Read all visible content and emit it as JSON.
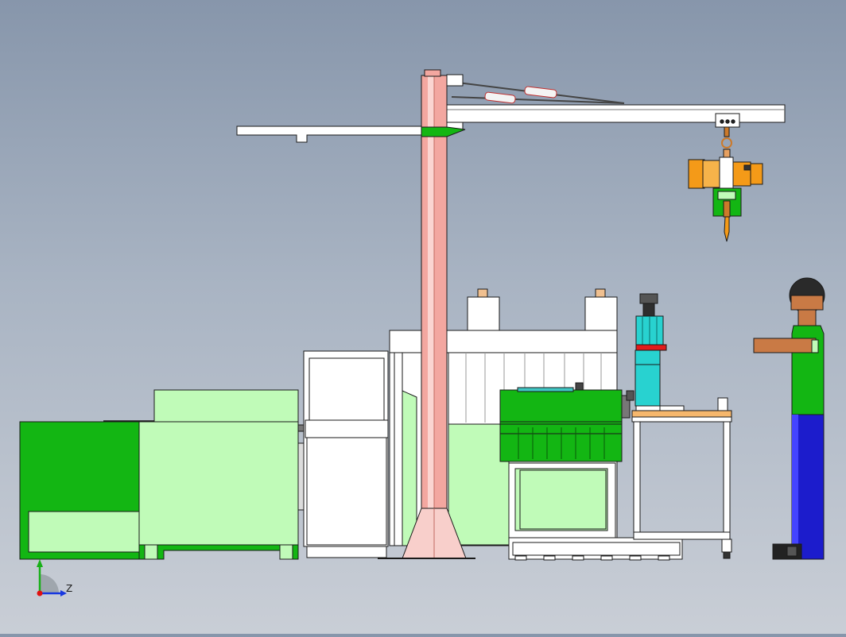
{
  "view": {
    "type": "cad-assembly-side-view",
    "background": [
      "#8796ab",
      "#c9ced6"
    ]
  },
  "triad": {
    "z_label": "Z",
    "colors": {
      "x": "#e01010",
      "y": "#18b018",
      "z": "#1838e0"
    }
  },
  "colors": {
    "bright_green": "#13b613",
    "light_green": "#c0fbb8",
    "pillar_pink": "#f3a7a0",
    "hoist_orange": "#f49a18",
    "teal": "#28d2d0",
    "navy": "#1c1ccc",
    "brown": "#c97a45",
    "outline": "#1a1a1a"
  },
  "components": [
    "operator-figure",
    "jib-crane",
    "electric-hoist",
    "green-enclosure",
    "fence-panel",
    "press-station",
    "work-table",
    "tool-on-table"
  ]
}
